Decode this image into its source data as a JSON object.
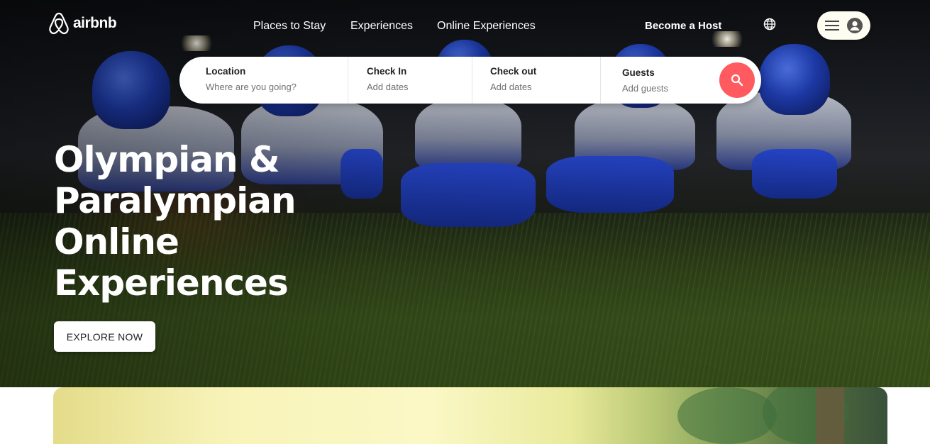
{
  "brand": {
    "name": "airbnb"
  },
  "nav": {
    "links": [
      "Places to Stay",
      "Experiences",
      "Online Experiences"
    ],
    "become_host": "Become a Host"
  },
  "search": {
    "location": {
      "title": "Location",
      "placeholder": "Where are you going?"
    },
    "check_in": {
      "title": "Check In",
      "placeholder": "Add dates"
    },
    "check_out": {
      "title": "Check out",
      "placeholder": "Add dates"
    },
    "guests": {
      "title": "Guests",
      "placeholder": "Add guests"
    }
  },
  "hero": {
    "headline_lines": [
      "Olympian &",
      "Paralympian",
      "Online",
      "Experiences"
    ],
    "cta_label": "EXPLORE NOW"
  },
  "colors": {
    "accent": "#ff5a5f",
    "pill_bg": "#fdfdf2"
  },
  "icons": [
    "airbnb-logo-icon",
    "globe-icon",
    "hamburger-menu-icon",
    "user-avatar-icon",
    "search-icon"
  ]
}
